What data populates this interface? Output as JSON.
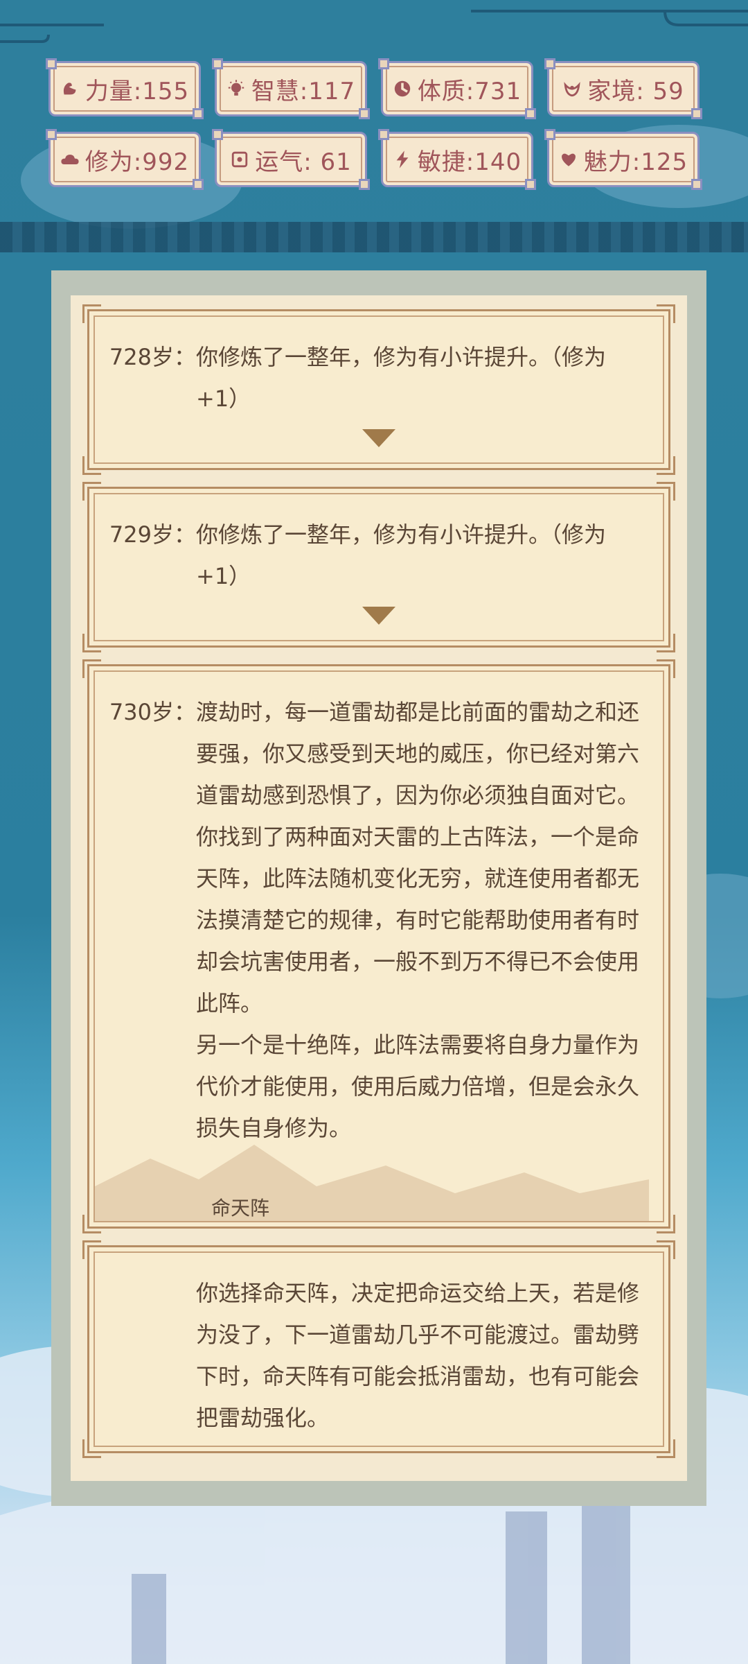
{
  "stats": [
    {
      "icon": "muscle-icon",
      "label": "力量:155"
    },
    {
      "icon": "lightbulb-icon",
      "label": "智慧:117"
    },
    {
      "icon": "body-icon",
      "label": "体质:731"
    },
    {
      "icon": "family-icon",
      "label": "家境: 59"
    },
    {
      "icon": "cloud-icon",
      "label": "修为:992"
    },
    {
      "icon": "luck-icon",
      "label": "运气: 61"
    },
    {
      "icon": "lightning-icon",
      "label": "敏捷:140"
    },
    {
      "icon": "heart-icon",
      "label": "魅力:125"
    }
  ],
  "colors": {
    "accent": "#a0555a",
    "card_border": "#b58c63",
    "panel": "#bcc4b8",
    "text": "#5a4636"
  },
  "log": [
    {
      "age": "728岁：",
      "paragraphs": [
        "你修炼了一整年，修为有小许提升。（修为+1）"
      ]
    },
    {
      "age": "729岁：",
      "paragraphs": [
        "你修炼了一整年，修为有小许提升。（修为+1）"
      ]
    },
    {
      "age": "730岁：",
      "paragraphs": [
        "渡劫时，每一道雷劫都是比前面的雷劫之和还要强，你又感受到天地的威压，你已经对第六道雷劫感到恐惧了，因为你必须独自面对它。",
        "你找到了两种面对天雷的上古阵法，一个是命天阵，此阵法随机变化无穷，就连使用者都无法摸清楚它的规律，有时它能帮助使用者有时却会坑害使用者，一般不到万不得已不会使用此阵。",
        "另一个是十绝阵，此阵法需要将自身力量作为代价才能使用，使用后威力倍增，但是会永久损失自身修为。"
      ],
      "choice": "命天阵"
    },
    {
      "age": "",
      "paragraphs": [
        "你选择命天阵，决定把命运交给上天，若是修为没了，下一道雷劫几乎不可能渡过。雷劫劈下时，命天阵有可能会抵消雷劫，也有可能会把雷劫强化。"
      ]
    }
  ]
}
